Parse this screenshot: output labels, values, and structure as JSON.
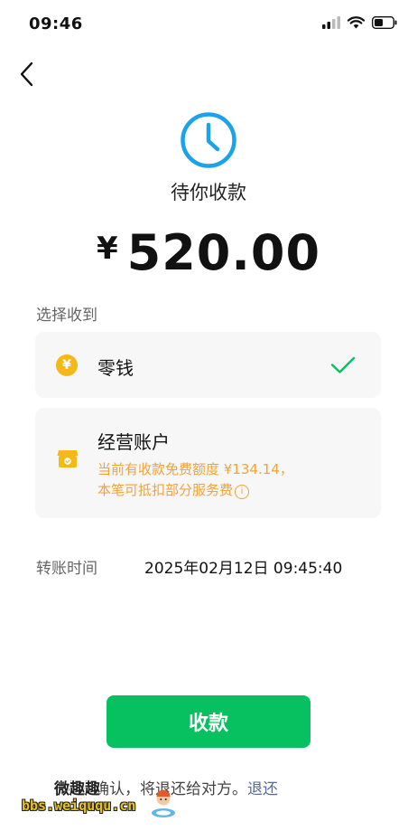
{
  "status_bar": {
    "time": "09:46",
    "icons": [
      "signal-icon",
      "wifi-icon",
      "battery-icon"
    ]
  },
  "nav": {
    "back_icon": "chevron-left-icon"
  },
  "header": {
    "status_icon": "clock-icon",
    "pending_label": "待你收款",
    "currency_symbol": "¥",
    "amount": "520.00"
  },
  "receive_to": {
    "section_label": "选择收到",
    "options": [
      {
        "icon": "coin-icon",
        "label": "零钱",
        "selected": true,
        "check_icon": "checkmark-icon"
      },
      {
        "icon": "store-icon",
        "label": "经营账户",
        "note_line1": "当前有收款免费额度 ¥134.14，",
        "note_line2": "本笔可抵扣部分服务费",
        "info_icon": "info-icon",
        "selected": false
      }
    ]
  },
  "transfer_time": {
    "label": "转账时间",
    "value": "2025年02月12日 09:45:40"
  },
  "actions": {
    "receive_button": "收款"
  },
  "footer": {
    "notice": "内未确认，将退还给对方。",
    "return_link": "退还"
  },
  "watermark": {
    "line1": "微趣趣",
    "line2": "bbs.weiququ.cn"
  },
  "colors": {
    "primary_green": "#07c160",
    "accent_blue": "#1aa3e8",
    "orange_note": "#f2a33a",
    "link_blue": "#576b95",
    "card_bg": "#f7f7f7"
  }
}
